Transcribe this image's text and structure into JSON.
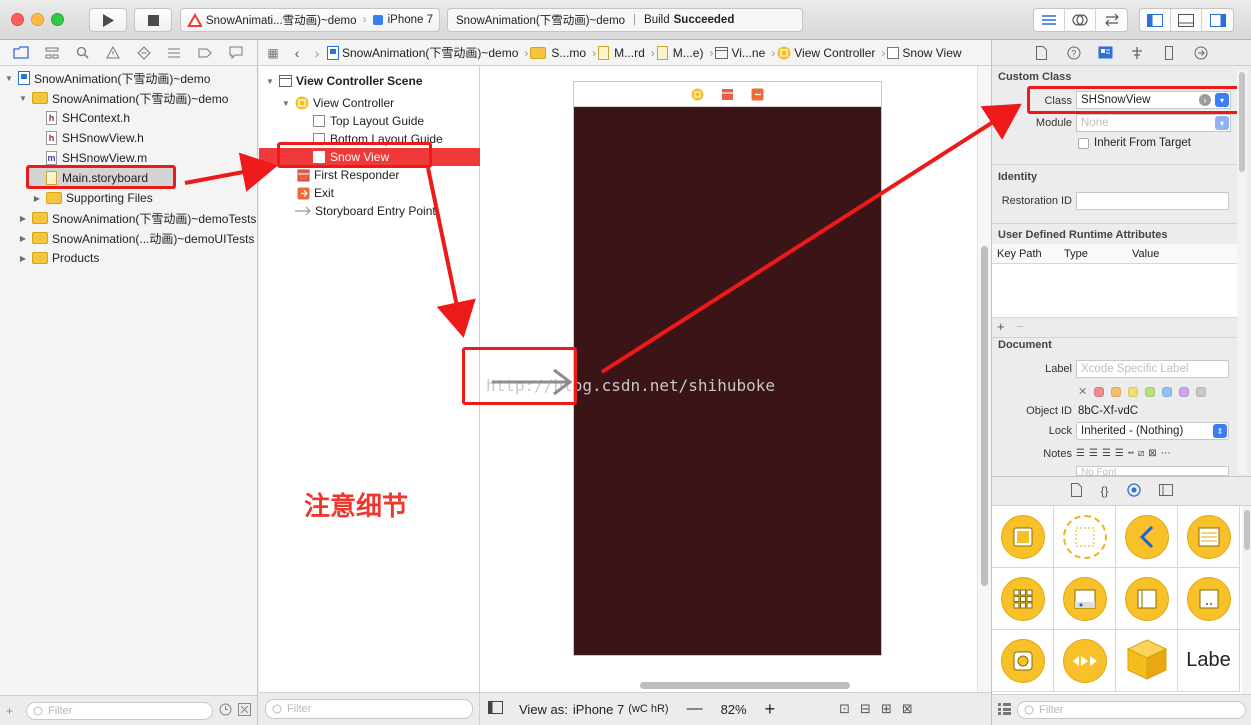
{
  "toolbar": {
    "scheme": "SnowAnimati...雪动画)~demo",
    "device": "iPhone 7",
    "status_project": "SnowAnimation(下雪动画)~demo",
    "status_label": "Build",
    "status_value": "Succeeded"
  },
  "navigator": {
    "items": [
      {
        "label": "SnowAnimation(下雪动画)~demo"
      },
      {
        "label": "SnowAnimation(下雪动画)~demo"
      },
      {
        "label": "SHContext.h"
      },
      {
        "label": "SHSnowView.h"
      },
      {
        "label": "SHSnowView.m"
      },
      {
        "label": "Main.storyboard"
      },
      {
        "label": "Supporting Files"
      },
      {
        "label": "SnowAnimation(下雪动画)~demoTests"
      },
      {
        "label": "SnowAnimation(...动画)~demoUITests"
      },
      {
        "label": "Products"
      }
    ],
    "filter_placeholder": "Filter"
  },
  "jumpbar": {
    "crumbs": [
      "SnowAnimation(下雪动画)~demo",
      "S...mo",
      "M...rd",
      "M...e)",
      "Vi...ne",
      "View Controller",
      "Snow View"
    ]
  },
  "outline": {
    "items": [
      {
        "label": "View Controller Scene"
      },
      {
        "label": "View Controller"
      },
      {
        "label": "Top Layout Guide"
      },
      {
        "label": "Bottom Layout Guide"
      },
      {
        "label": "Snow View"
      },
      {
        "label": "First Responder"
      },
      {
        "label": "Exit"
      },
      {
        "label": "Storyboard Entry Point"
      }
    ],
    "filter_placeholder": "Filter"
  },
  "canvas": {
    "watermark": "http://blog.csdn.net/shihuboke",
    "annotation_note": "注意细节",
    "view_bg": "#3a1416"
  },
  "editor_bottom": {
    "view_as_label": "View as:",
    "view_as_device": "iPhone 7",
    "size_class": "(wC hR)",
    "zoom": "82%"
  },
  "inspector": {
    "custom_class": {
      "title": "Custom Class",
      "class_label": "Class",
      "class_value": "SHSnowView",
      "module_label": "Module",
      "module_placeholder": "None",
      "inherit_label": "Inherit From Target"
    },
    "identity": {
      "title": "Identity",
      "restoration_label": "Restoration ID"
    },
    "runtime_attrs": {
      "title": "User Defined Runtime Attributes",
      "columns": [
        "Key Path",
        "Type",
        "Value"
      ]
    },
    "document": {
      "title": "Document",
      "label_label": "Label",
      "label_placeholder": "Xcode Specific Label",
      "object_id_label": "Object ID",
      "object_id_value": "8bC-Xf-vdC",
      "lock_label": "Lock",
      "lock_value": "Inherited - (Nothing)",
      "notes_label": "Notes",
      "font_placeholder": "No Font"
    },
    "library": {
      "last_label": "Labe"
    },
    "filter_placeholder": "Filter"
  },
  "colors": {
    "annotation_red": "#ee1a1a",
    "selection_red": "#f03a3a",
    "accent_blue": "#3a7ef4"
  }
}
